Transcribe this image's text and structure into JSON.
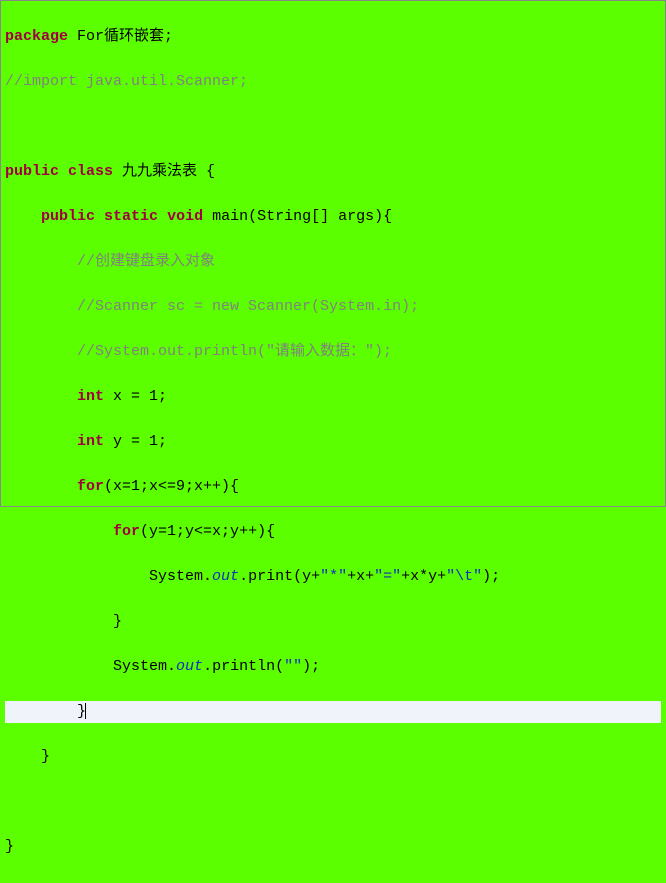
{
  "code": {
    "line1_kw": "package",
    "line1_pkg": " For循环嵌套;",
    "line2_comment": "//import java.util.Scanner;",
    "line4_kw1": "public",
    "line4_kw2": "class",
    "line4_name": " 九九乘法表 {",
    "line5_kw1": "public",
    "line5_kw2": "static",
    "line5_kw3": "void",
    "line5_rest": " main(String[] args){",
    "line6_comment": "//创建键盘录入对象",
    "line7_comment": "//Scanner sc = new Scanner(System.in);",
    "line8_comment": "//System.out.println(\"请输入数据：\");",
    "line9_kw": "int",
    "line9_rest": " x = 1;",
    "line10_kw": "int",
    "line10_rest": " y = 1;",
    "line11_kw": "for",
    "line11_rest": "(x=1;x<=9;x++){",
    "line12_kw": "for",
    "line12_rest": "(y=1;y<=x;y++){",
    "line13_pre": "System.",
    "line13_out": "out",
    "line13_print": ".print(y+",
    "line13_s1": "\"*\"",
    "line13_mid1": "+x+",
    "line13_s2": "\"=\"",
    "line13_mid2": "+x*y+",
    "line13_s3": "\"\\t\"",
    "line13_end": ");",
    "line14_brace": "}",
    "line15_pre": "System.",
    "line15_out": "out",
    "line15_print": ".println(",
    "line15_s": "\"\"",
    "line15_end": ");",
    "line16_brace": "}",
    "line17_brace": "}",
    "line19_brace": "}"
  }
}
